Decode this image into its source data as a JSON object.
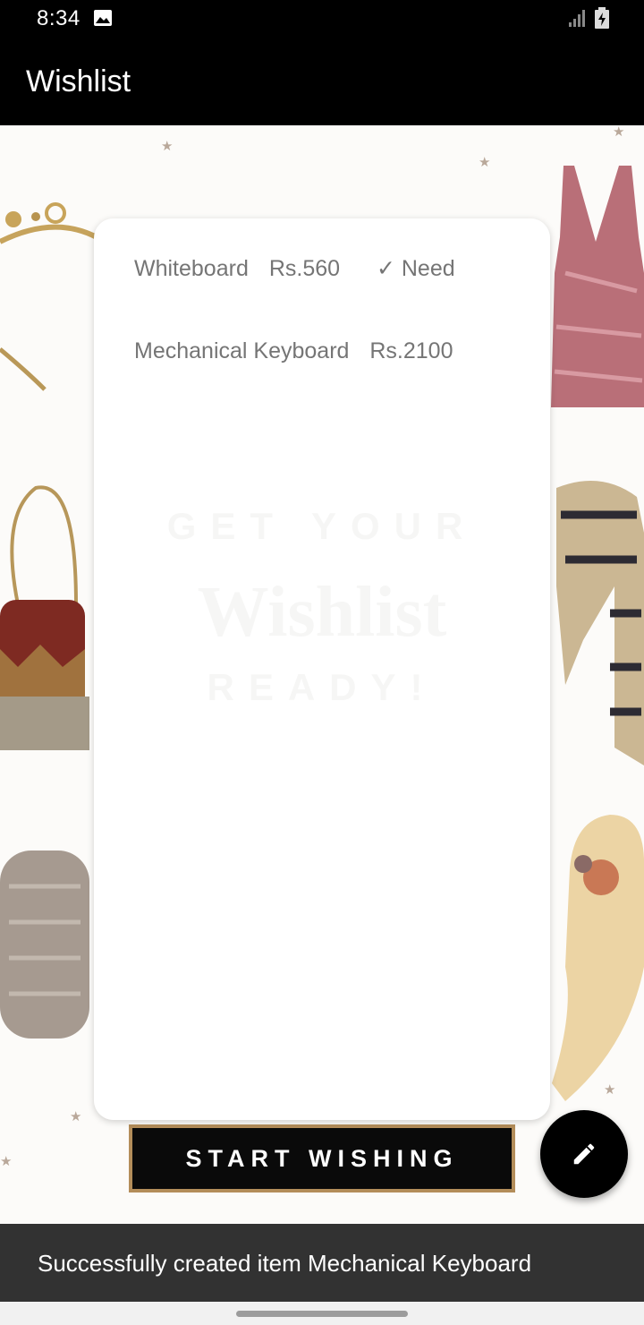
{
  "status_bar": {
    "time": "8:34",
    "icons": [
      "gallery-icon",
      "signal-icon",
      "battery-charging-icon"
    ]
  },
  "app_bar": {
    "title": "Wishlist"
  },
  "wishlist": {
    "items": [
      {
        "name": "Whiteboard",
        "price": "Rs.560",
        "tag": "✓ Need"
      },
      {
        "name": "Mechanical Keyboard",
        "price": "Rs.2100",
        "tag": ""
      }
    ]
  },
  "background": {
    "ghost_text": [
      "GET YOUR",
      "Wishlist",
      "READY!"
    ],
    "banner_label": "START WISHING"
  },
  "fab": {
    "icon": "pencil-icon"
  },
  "snackbar": {
    "message": "Successfully created item Mechanical Keyboard"
  },
  "colors": {
    "bars": "#000000",
    "item_text": "#757575",
    "snackbar": "#323232",
    "banner_border": "#b38d5a"
  }
}
